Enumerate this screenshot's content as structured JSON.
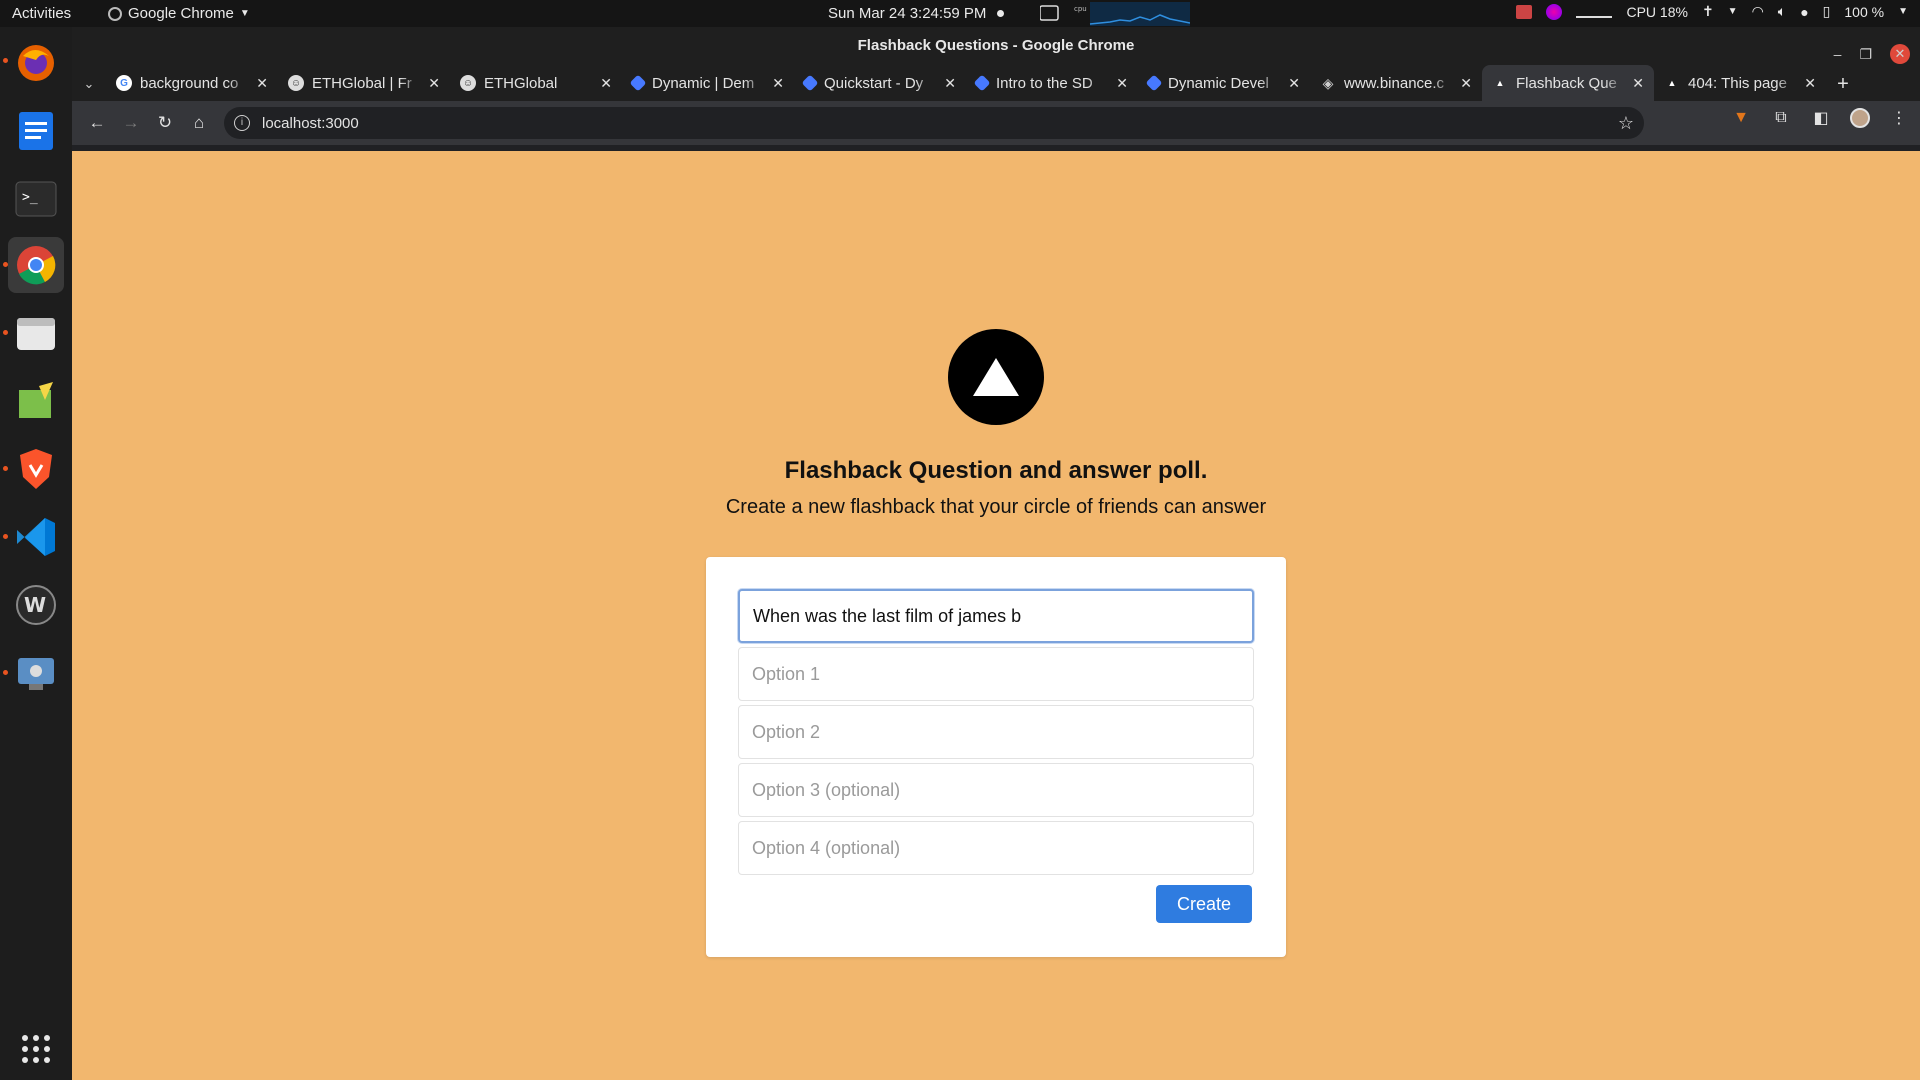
{
  "system_bar": {
    "activities": "Activities",
    "app_name": "Google Chrome",
    "clock": "Sun Mar 24   3:24:59 PM",
    "cpu": "CPU 18%",
    "battery": "100 %"
  },
  "dock": {
    "items": [
      "firefox",
      "docs",
      "terminal",
      "chrome",
      "files",
      "drawing",
      "brave",
      "vscode",
      "webstorm",
      "screenshot"
    ]
  },
  "window": {
    "title": "Flashback Questions - Google Chrome"
  },
  "tabs": [
    {
      "title": "background co",
      "favicon": "google-icon"
    },
    {
      "title": "ETHGlobal | Fr",
      "favicon": "ethglobal-icon"
    },
    {
      "title": "ETHGlobal",
      "favicon": "ethglobal-icon"
    },
    {
      "title": "Dynamic | Dem",
      "favicon": "dynamic-icon"
    },
    {
      "title": "Quickstart - Dy",
      "favicon": "dynamic-icon"
    },
    {
      "title": "Intro to the SD",
      "favicon": "dynamic-icon"
    },
    {
      "title": "Dynamic Devel",
      "favicon": "dynamic-icon"
    },
    {
      "title": "www.binance.c",
      "favicon": "binance-icon"
    },
    {
      "title": "Flashback Que",
      "favicon": "triangle-icon",
      "active": true
    },
    {
      "title": "404: This page",
      "favicon": "triangle-icon"
    }
  ],
  "address_bar": {
    "url": "localhost:3000"
  },
  "page": {
    "heading": "Flashback Question and answer poll.",
    "subheading": "Create a new flashback that your circle of friends can answer",
    "question_value": "When was the last film of james b",
    "option1_placeholder": "Option 1",
    "option2_placeholder": "Option 2",
    "option3_placeholder": "Option 3 (optional)",
    "option4_placeholder": "Option 4 (optional)",
    "create_label": "Create"
  },
  "colors": {
    "page_bg": "#f2b76e",
    "button": "#2f7ce0"
  }
}
